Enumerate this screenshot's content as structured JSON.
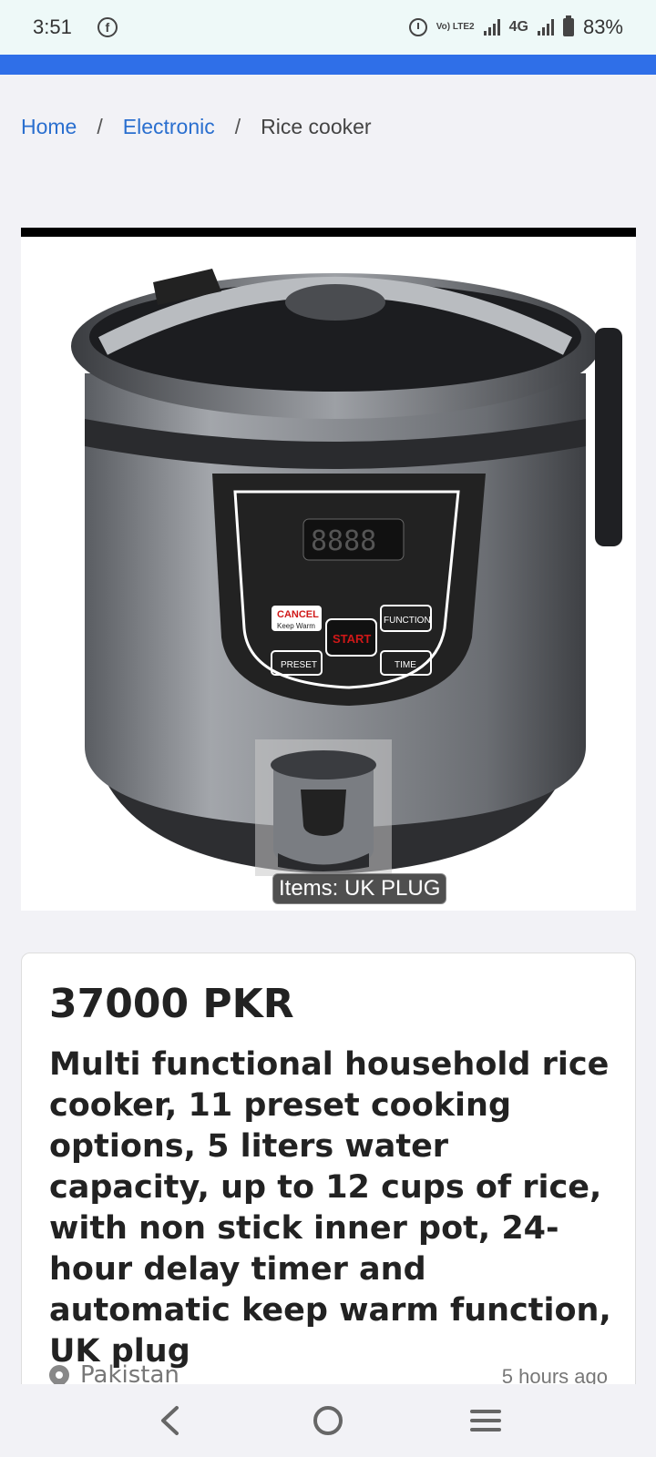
{
  "status_bar": {
    "time": "3:51",
    "network": "4G",
    "volte": "Vo) LTE2",
    "battery": "83%",
    "icons": [
      "facebook-icon",
      "alarm-icon",
      "signal-icon",
      "battery-icon"
    ]
  },
  "breadcrumb": {
    "items": [
      "Home",
      "Electronic",
      "Rice cooker"
    ],
    "separator": "/"
  },
  "product_image": {
    "caption": "Items: UK PLUG",
    "display_labels": {
      "cancel": "CANCEL",
      "keep_warm": "Keep Warm",
      "start": "START",
      "function": "FUNCTION",
      "preset": "PRESET",
      "time": "TIME",
      "digits": "8888"
    }
  },
  "product": {
    "price": "37000 PKR",
    "title": "Multi functional household rice cooker, 11 preset cooking options, 5 liters water capacity, up to 12 cups of rice, with non stick inner pot, 24-hour delay timer and automatic keep warm function, UK plug",
    "location": "Pakistan",
    "posted": "5 hours ago"
  },
  "nav": {
    "back": "back-icon",
    "home": "home-icon",
    "menu": "menu-icon"
  },
  "colors": {
    "accent": "#2f6fe8",
    "link": "#2a6fcf",
    "status_bg": "#eef9f8"
  }
}
